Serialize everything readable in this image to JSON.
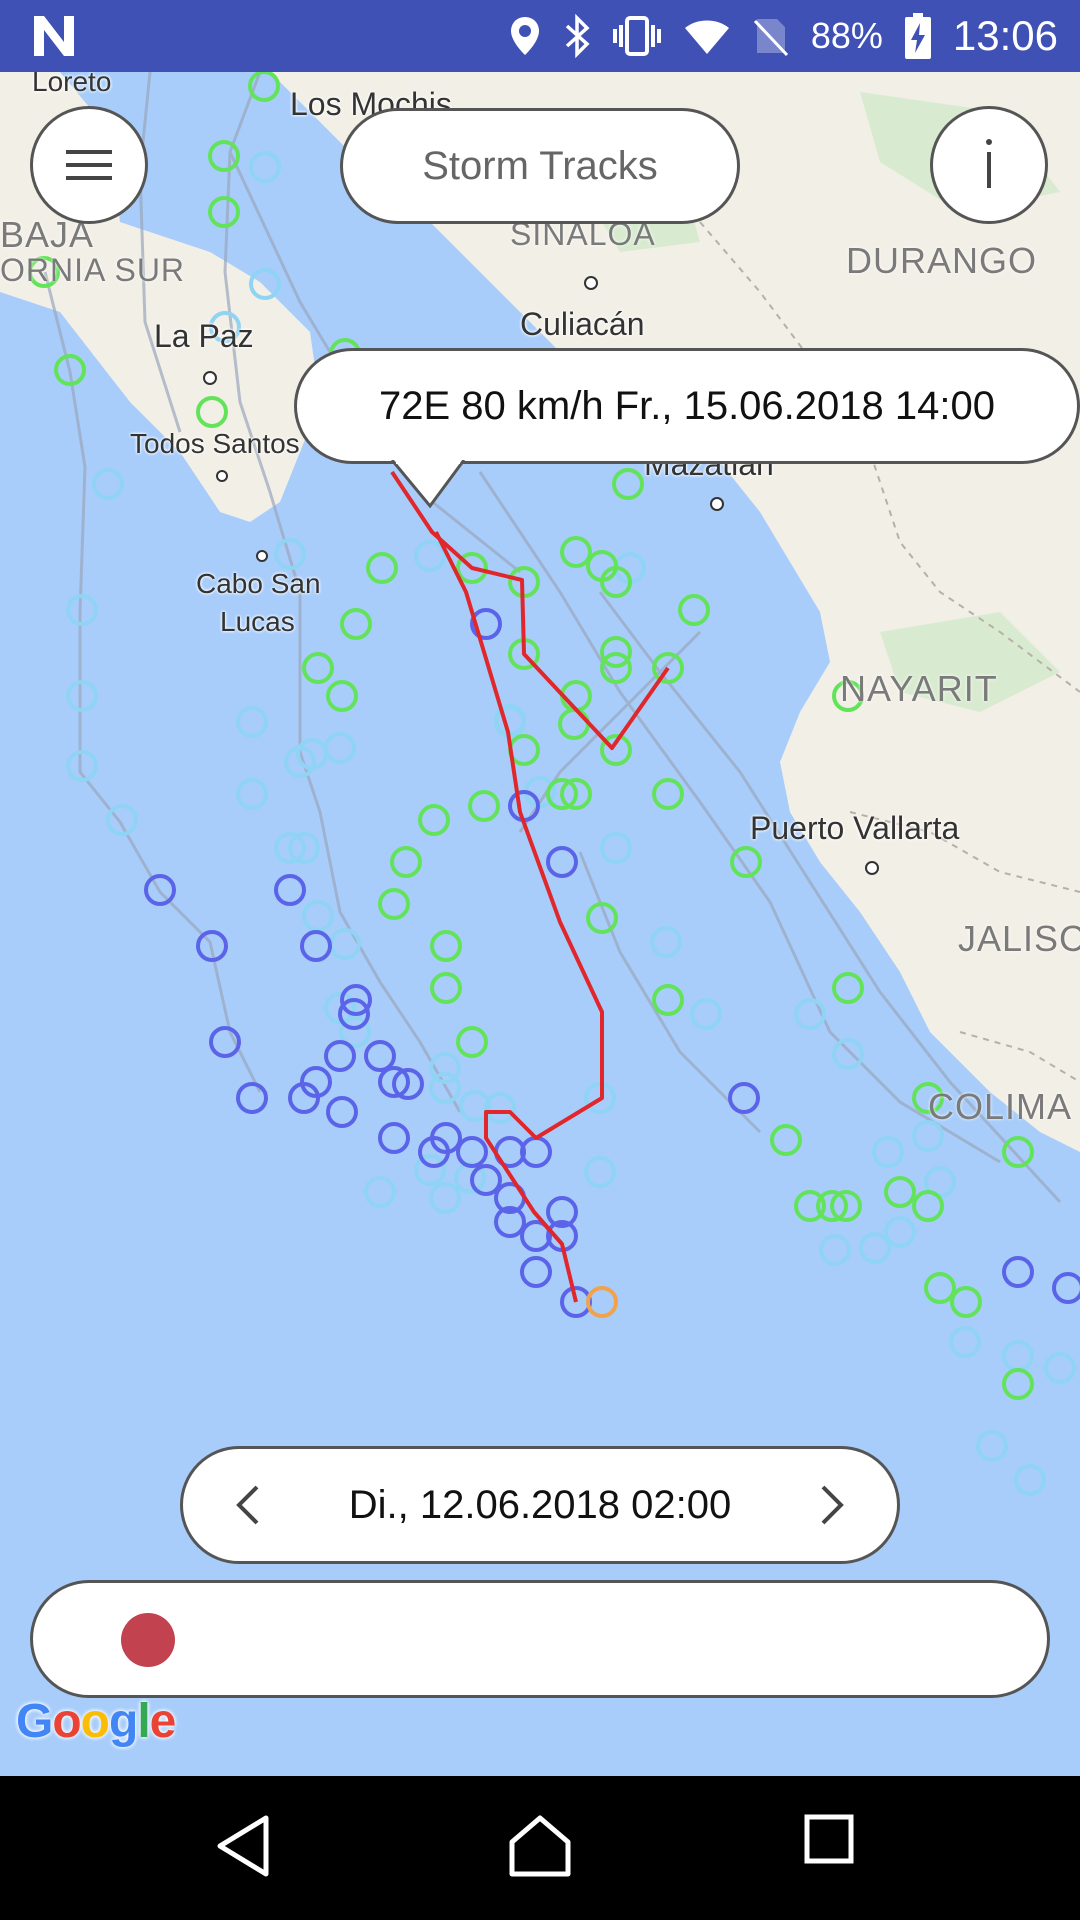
{
  "status_bar": {
    "battery_percent": "88%",
    "time": "13:06",
    "icons": [
      "n-logo-icon",
      "location-icon",
      "bluetooth-icon",
      "vibrate-icon",
      "wifi-icon",
      "no-sim-icon",
      "battery-charging-icon"
    ]
  },
  "header": {
    "title": "Storm Tracks",
    "menu_icon": "hamburger-menu-icon",
    "info_icon": "info-icon"
  },
  "tooltip": {
    "text": "72E 80 km/h Fr., 15.06.2018 14:00"
  },
  "map": {
    "places": {
      "loreto": "Loreto",
      "los_mochis": "Los Mochis",
      "baja": "BAJA",
      "ornia_sur": "ORNIA SUR",
      "sinaloa": "SINALOA",
      "durango": "DURANGO",
      "culiacan": "Culiacán",
      "la_paz": "La Paz",
      "todos_santos": "Todos Santos",
      "mazatlan": "Mazatlán",
      "cabo": "Cabo San",
      "lucas": "Lucas",
      "nayarit": "NAYARIT",
      "puerto_vallarta": "Puerto Vallarta",
      "jalisco": "JALISCO",
      "colima": "COLIMA"
    },
    "colors": {
      "ocean": "#a8cdfa",
      "land": "#f2efe6",
      "selected_track": "#e0282c",
      "track_blue": "#5b63e8",
      "track_cyan": "#8fd3f5",
      "track_green": "#62e35a",
      "track_orange": "#f2a24a"
    }
  },
  "timeline": {
    "date_label": "Di., 12.06.2018 02:00",
    "prev_icon": "chevron-left-icon",
    "next_icon": "chevron-right-icon",
    "slider_position": 0.0
  },
  "attribution": {
    "logo": "Google"
  },
  "nav_bar": {
    "icons": [
      "back-icon",
      "home-icon",
      "recents-icon"
    ]
  }
}
